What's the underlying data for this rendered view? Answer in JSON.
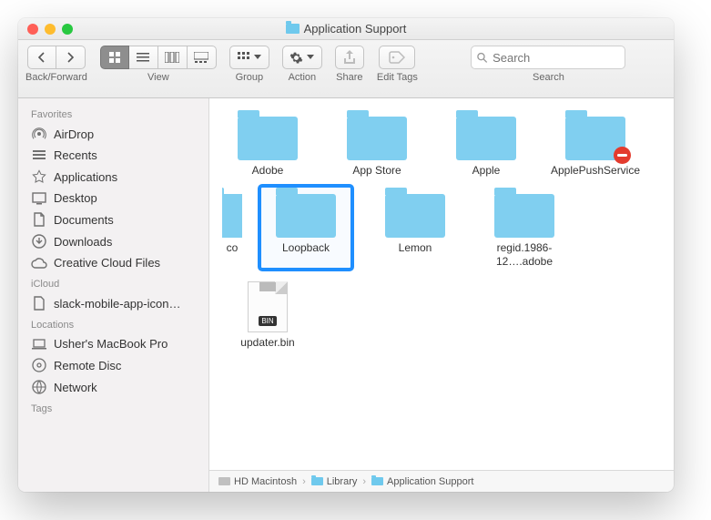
{
  "window": {
    "title": "Application Support"
  },
  "toolbar": {
    "back_forward_label": "Back/Forward",
    "view_label": "View",
    "group_label": "Group",
    "action_label": "Action",
    "share_label": "Share",
    "tags_label": "Edit Tags",
    "search_label": "Search",
    "search_placeholder": "Search"
  },
  "sidebar": {
    "sections": [
      {
        "title": "Favorites",
        "items": [
          {
            "id": "airdrop",
            "label": "AirDrop",
            "icon": "airdrop-icon"
          },
          {
            "id": "recents",
            "label": "Recents",
            "icon": "recents-icon"
          },
          {
            "id": "applications",
            "label": "Applications",
            "icon": "applications-icon"
          },
          {
            "id": "desktop",
            "label": "Desktop",
            "icon": "desktop-icon"
          },
          {
            "id": "documents",
            "label": "Documents",
            "icon": "documents-icon"
          },
          {
            "id": "downloads",
            "label": "Downloads",
            "icon": "downloads-icon"
          },
          {
            "id": "creative-cloud",
            "label": "Creative Cloud Files",
            "icon": "creative-cloud-icon"
          }
        ]
      },
      {
        "title": "iCloud",
        "items": [
          {
            "id": "slack-icon-doc",
            "label": "slack-mobile-app-icon…",
            "icon": "document-icon"
          }
        ]
      },
      {
        "title": "Locations",
        "items": [
          {
            "id": "macbook",
            "label": "Usher's MacBook Pro",
            "icon": "laptop-icon"
          },
          {
            "id": "remote-disc",
            "label": "Remote Disc",
            "icon": "disc-icon"
          },
          {
            "id": "network",
            "label": "Network",
            "icon": "network-icon"
          }
        ]
      },
      {
        "title": "Tags",
        "items": []
      }
    ]
  },
  "files": [
    {
      "name": "Adobe",
      "type": "folder"
    },
    {
      "name": "App Store",
      "type": "folder"
    },
    {
      "name": "Apple",
      "type": "folder"
    },
    {
      "name": "ApplePushService",
      "type": "folder",
      "badge": "no-entry"
    },
    {
      "name": "co",
      "type": "folder",
      "partial": true
    },
    {
      "name": "Loopback",
      "type": "folder",
      "selected": true
    },
    {
      "name": "Lemon",
      "type": "folder"
    },
    {
      "name": "regid.1986-12….adobe",
      "type": "folder"
    },
    {
      "name": "updater.bin",
      "type": "bin"
    }
  ],
  "pathbar": [
    {
      "label": "HD Macintosh",
      "icon": "hdd"
    },
    {
      "label": "Library",
      "icon": "folder"
    },
    {
      "label": "Application Support",
      "icon": "folder"
    }
  ]
}
